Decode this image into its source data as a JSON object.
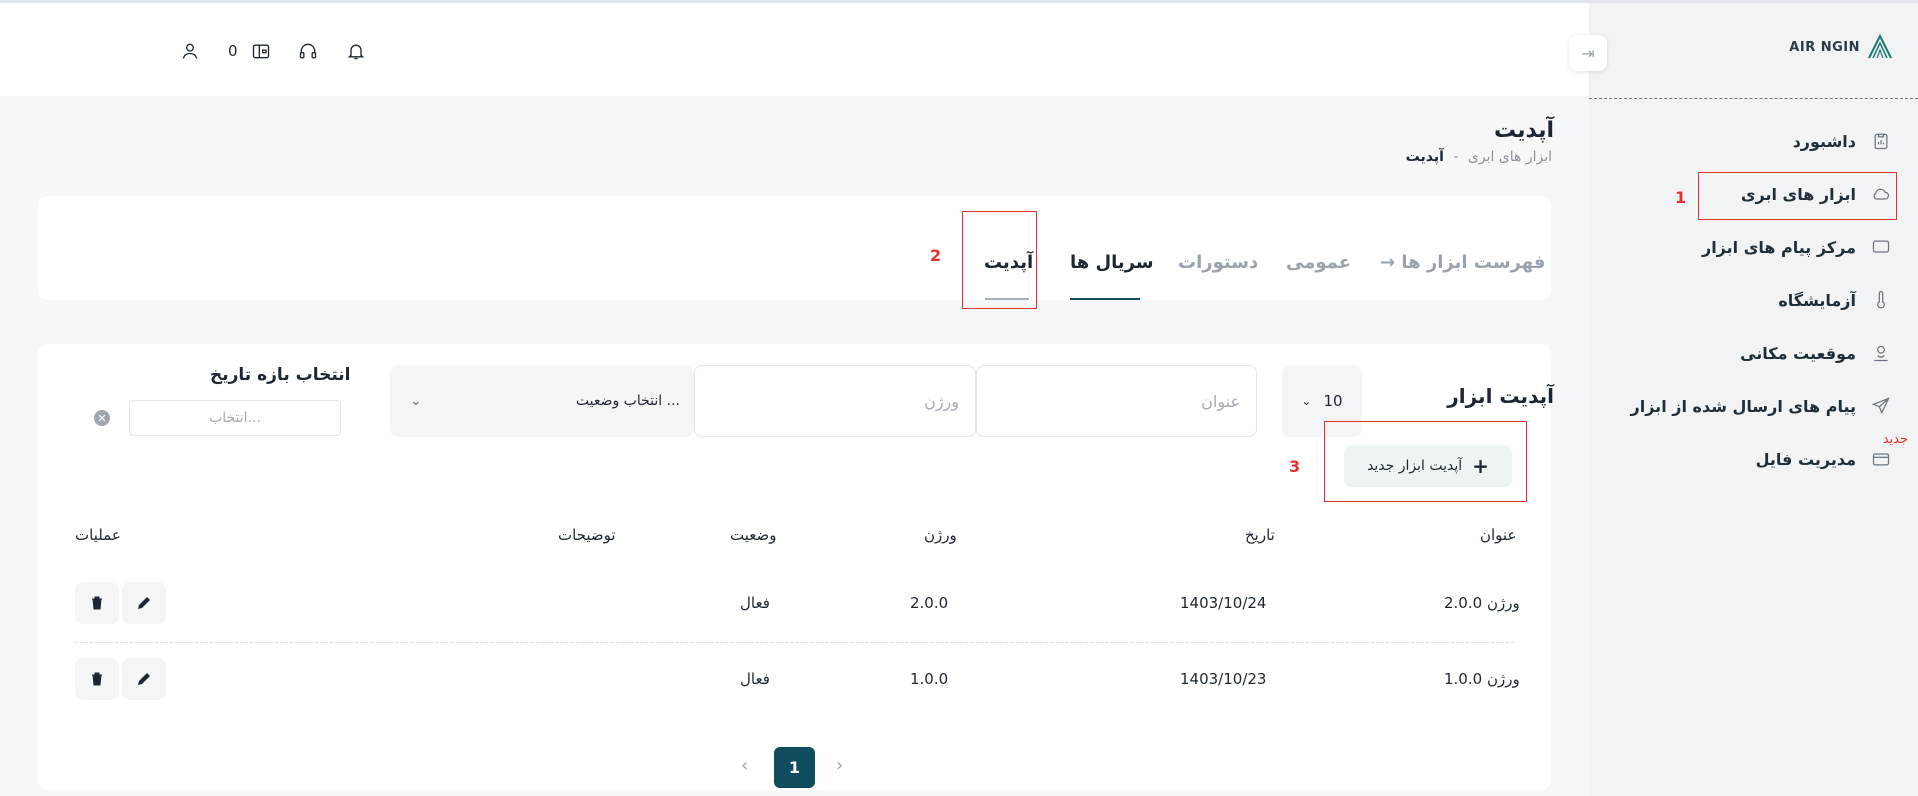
{
  "sidebar": {
    "logo_text": "AIR NGIN",
    "items": [
      {
        "label": "داشبورد",
        "icon": "clipboard-icon"
      },
      {
        "label": "ابزار های ابری",
        "icon": "cloud-icon"
      },
      {
        "label": "مرکز پیام های ابزار",
        "icon": "message-icon"
      },
      {
        "label": "آزمایشگاه",
        "icon": "thermometer-icon"
      },
      {
        "label": "موقعیت مکانی",
        "icon": "location-icon"
      },
      {
        "label": "پیام های ارسال شده از ابزار",
        "icon": "send-icon"
      },
      {
        "label": "مدیریت فایل",
        "icon": "folder-icon"
      }
    ],
    "new_badge": "جدید"
  },
  "annotations": {
    "one": "1",
    "two": "2",
    "three": "3"
  },
  "header": {
    "wallet_count": "0"
  },
  "page": {
    "title": "آپدیت",
    "breadcrumb_parent": "ابزار های ابری",
    "breadcrumb_sep": "-",
    "breadcrumb_current": "آپدیت"
  },
  "tabs": [
    {
      "label": "→ فهرست ابزار ها"
    },
    {
      "label": "عمومی"
    },
    {
      "label": "دستورات"
    },
    {
      "label": "سریال ها"
    },
    {
      "label": "آپدیت"
    }
  ],
  "filters": {
    "section_title": "آپدیت ابزار",
    "page_size": "10",
    "title_placeholder": "عنوان",
    "version_placeholder": "ورژن",
    "status_placeholder": "انتخاب وضعیت ...",
    "date_label": "انتخاب بازه تاریخ",
    "date_placeholder": "انتخاب..."
  },
  "add_button": {
    "label": "آپدیت ابزار جدید",
    "plus": "+"
  },
  "table": {
    "headers": {
      "title": "عنوان",
      "date": "تاریخ",
      "version": "ورژن",
      "status": "وضعیت",
      "description": "توضیحات",
      "actions": "عملیات"
    },
    "rows": [
      {
        "title": "ورژن 2.0.0",
        "date": "1403/10/24",
        "version": "2.0.0",
        "status": "فعال",
        "description": ""
      },
      {
        "title": "ورژن 1.0.0",
        "date": "1403/10/23",
        "version": "1.0.0",
        "status": "فعال",
        "description": ""
      }
    ]
  },
  "pagination": {
    "current": "1",
    "prev": "‹",
    "next": "›"
  },
  "colors": {
    "primary": "#0f4c5c",
    "highlight": "#e03131"
  }
}
